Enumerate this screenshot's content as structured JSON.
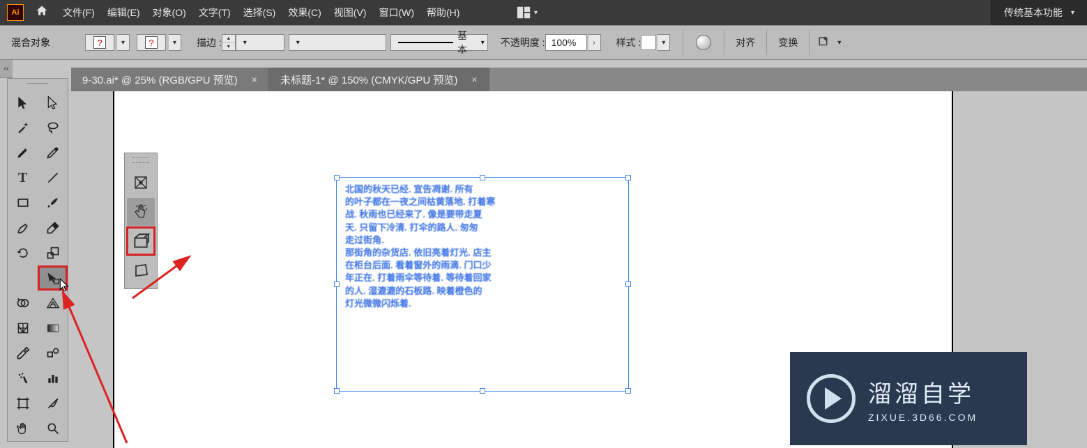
{
  "app": {
    "logo": "Ai"
  },
  "menu": {
    "items": [
      {
        "label": "文件(F)"
      },
      {
        "label": "编辑(E)"
      },
      {
        "label": "对象(O)"
      },
      {
        "label": "文字(T)"
      },
      {
        "label": "选择(S)"
      },
      {
        "label": "效果(C)"
      },
      {
        "label": "视图(V)"
      },
      {
        "label": "窗口(W)"
      },
      {
        "label": "帮助(H)"
      }
    ]
  },
  "workspace": {
    "label": "传统基本功能"
  },
  "options": {
    "selection_label": "混合对象",
    "fill_mark": "?",
    "stroke_mark": "?",
    "stroke_label": "描边 :",
    "brush_preset_label": "基本",
    "opacity_label": "不透明度 :",
    "opacity_value": "100%",
    "style_label": "样式 :",
    "align_label": "对齐",
    "transform_label": "变换"
  },
  "tabs": [
    {
      "title": "9-30.ai* @ 25% (RGB/GPU 预览)",
      "active": false
    },
    {
      "title": "未标题-1* @ 150% (CMYK/GPU 预览)",
      "active": true
    }
  ],
  "toolbox": {
    "rows": [
      [
        "selection-tool",
        "direct-selection-tool"
      ],
      [
        "magic-wand-tool",
        "lasso-tool"
      ],
      [
        "pen-tool",
        "curvature-tool"
      ],
      [
        "type-tool",
        "line-tool"
      ],
      [
        "rectangle-tool",
        "paintbrush-tool"
      ],
      [
        "shaper-tool",
        "eraser-tool"
      ],
      [
        "rotate-tool",
        "scale-tool"
      ],
      [
        "width-tool",
        "free-transform-tool"
      ],
      [
        "shape-builder-tool",
        "perspective-tool"
      ],
      [
        "mesh-tool",
        "gradient-tool"
      ],
      [
        "eyedropper-tool",
        "blend-tool"
      ],
      [
        "symbol-sprayer-tool",
        "column-graph-tool"
      ],
      [
        "artboard-tool",
        "slice-tool"
      ],
      [
        "hand-tool",
        "zoom-tool"
      ]
    ],
    "highlight_row": 7,
    "highlight_col": 1
  },
  "subtool": {
    "items": [
      "puppet-warp-tool",
      "free-transform-touch",
      "free-transform-constrain",
      "free-distort-tool"
    ],
    "selected_index": 1,
    "highlighted_index": 2
  },
  "watermark": {
    "cn": "溜溜自学",
    "url": "ZIXUE.3D66.COM"
  },
  "chevron": "‹‹"
}
